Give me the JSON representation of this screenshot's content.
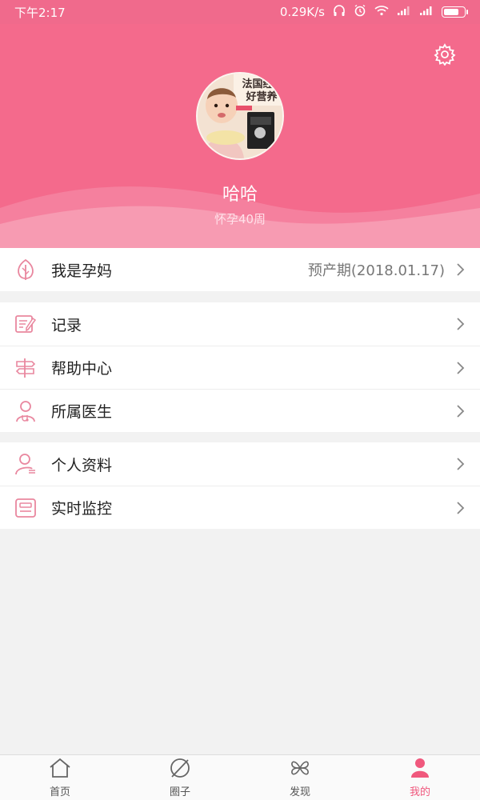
{
  "status_bar": {
    "time": "下午2:17",
    "speed": "0.29K/s"
  },
  "header": {
    "username": "哈哈",
    "subtitle": "怀孕40周",
    "settings_icon": "gear-icon",
    "avatar_text_1": "法国经",
    "avatar_text_2": "好营养"
  },
  "colors": {
    "brand": "#f46a8c",
    "icon": "#e9879f",
    "active_tab": "#f0587d"
  },
  "groups": [
    {
      "items": [
        {
          "label": "我是孕妈",
          "value": "预产期(2018.01.17)",
          "icon": "leaf-icon"
        }
      ]
    },
    {
      "items": [
        {
          "label": "记录",
          "value": "",
          "icon": "notes-icon"
        },
        {
          "label": "帮助中心",
          "value": "",
          "icon": "signpost-icon"
        },
        {
          "label": "所属医生",
          "value": "",
          "icon": "doctor-icon"
        }
      ]
    },
    {
      "items": [
        {
          "label": "个人资料",
          "value": "",
          "icon": "profile-icon"
        },
        {
          "label": "实时监控",
          "value": "",
          "icon": "monitor-icon"
        }
      ]
    }
  ],
  "tabbar": {
    "tabs": [
      {
        "label": "首页",
        "icon": "home-icon",
        "active": false
      },
      {
        "label": "圈子",
        "icon": "circle-leaf-icon",
        "active": false
      },
      {
        "label": "发现",
        "icon": "clover-icon",
        "active": false
      },
      {
        "label": "我的",
        "icon": "user-icon",
        "active": true
      }
    ]
  }
}
